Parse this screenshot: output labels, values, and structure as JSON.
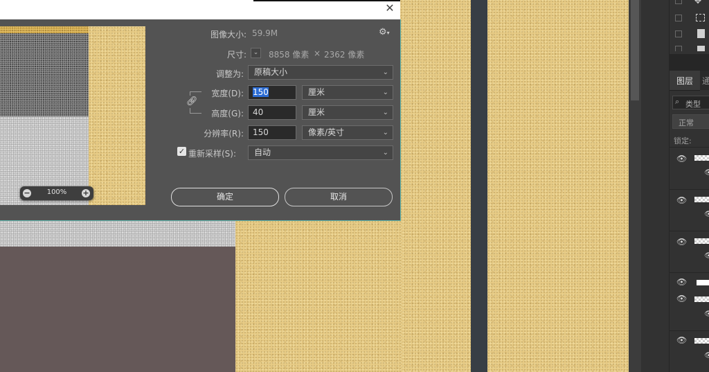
{
  "dialog": {
    "image_size_label": "图像大小:",
    "image_size_value": "59.9M",
    "dimensions_label": "尺寸:",
    "dimensions_width": "8858 像素",
    "dimensions_times": "×",
    "dimensions_height": "2362 像素",
    "fit_to_label": "调整为:",
    "fit_to_value": "原稿大小",
    "width_label": "宽度(D):",
    "width_value": "150",
    "width_unit": "厘米",
    "height_label": "高度(G):",
    "height_value": "40",
    "height_unit": "厘米",
    "resolution_label": "分辨率(R):",
    "resolution_value": "150",
    "resolution_unit": "像素/英寸",
    "resample_label": "重新采样(S):",
    "resample_value": "自动",
    "resample_checked": true,
    "zoom_level": "100%",
    "ok_label": "确定",
    "cancel_label": "取消",
    "gear_icon": "gear-icon",
    "close_icon": "close-icon"
  },
  "panel": {
    "layers_tab": "图层",
    "layers_tab2": "通",
    "filter_label": "类型",
    "blend_mode": "正常",
    "lock_label": "锁定:"
  },
  "colors": {
    "dialog_bg": "#535353",
    "dialog_border": "#5fb7ad",
    "panel_bg": "#2f2f2f",
    "highlight": "#2b6cd4",
    "paper": "#e8cc86",
    "mauve": "#655858"
  }
}
